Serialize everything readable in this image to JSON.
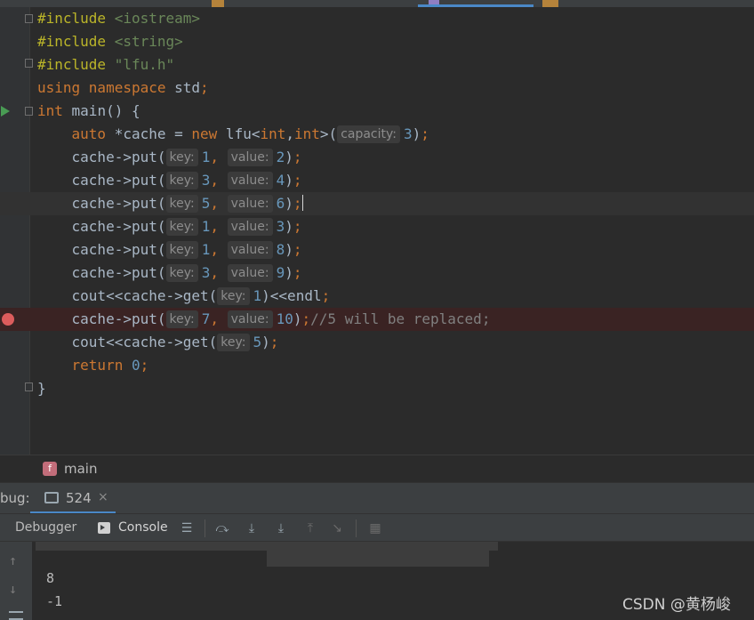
{
  "editor": {
    "lines": [
      {
        "text": "#include <iostream>"
      },
      {
        "text": "#include <string>"
      },
      {
        "text": "#include \"lfu.h\""
      },
      {
        "text": "using namespace std;"
      },
      {
        "text": "int main() {"
      },
      {
        "text": "    auto *cache = new lfu<int,int>(capacity: 3);",
        "hint_capacity": "capacity:"
      },
      {
        "text": "    cache->put(key: 1, value: 2);"
      },
      {
        "text": "    cache->put(key: 3, value: 4);"
      },
      {
        "text": "    cache->put(key: 5, value: 6);"
      },
      {
        "text": "    cache->put(key: 1, value: 3);"
      },
      {
        "text": "    cache->put(key: 1, value: 8);"
      },
      {
        "text": "    cache->put(key: 3, value: 9);"
      },
      {
        "text": "    cout<<cache->get(key: 1)<<endl;"
      },
      {
        "text": "    cache->put(key: 7, value: 10);//5 will be replaced;"
      },
      {
        "text": "    cout<<cache->get(key: 5);"
      },
      {
        "text": "    return 0;"
      },
      {
        "text": "}"
      }
    ],
    "hints": {
      "capacity": "capacity:",
      "key": "key:",
      "value": "value:"
    }
  },
  "breadcrumb": {
    "badge": "f",
    "label": "main"
  },
  "debug": {
    "title": "bug:",
    "session_label": "524",
    "session_close": "×",
    "tabs": {
      "debugger": "Debugger",
      "console": "Console"
    }
  },
  "console": {
    "output": [
      "8",
      "-1"
    ]
  },
  "watermark": "CSDN @黄杨峻",
  "colors": {
    "keyword": "#cc7832",
    "string": "#6a8759",
    "number": "#6897bb",
    "comment": "#808080",
    "accent": "#4a88c7",
    "breakpoint": "#db5c5c"
  }
}
